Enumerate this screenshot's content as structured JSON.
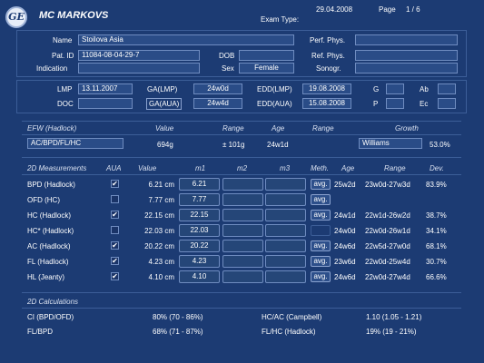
{
  "header": {
    "title": "MC MARKOVS",
    "exam_type_label": "Exam Type:",
    "date": "29.04.2008",
    "page_label": "Page",
    "page_value": "1 / 6",
    "logo_text": "GE"
  },
  "patient": {
    "name_label": "Name",
    "name": "Stoilova Asia",
    "patid_label": "Pat. ID",
    "patid": "11084-08-04-29-7",
    "indication_label": "Indication",
    "indication": "",
    "dob_label": "DOB",
    "dob": "",
    "sex_label": "Sex",
    "sex": "Female",
    "perf_label": "Perf. Phys.",
    "perf": "",
    "ref_label": "Ref. Phys.",
    "ref": "",
    "sono_label": "Sonogr.",
    "sono": ""
  },
  "dates": {
    "lmp_label": "LMP",
    "lmp": "13.11.2007",
    "doc_label": "DOC",
    "doc": "",
    "galmp_label": "GA(LMP)",
    "galmp": "24w0d",
    "gaaua_label": "GA(AUA)",
    "gaaua": "24w4d",
    "eddlmp_label": "EDD(LMP)",
    "eddlmp": "19.08.2008",
    "eddaua_label": "EDD(AUA)",
    "eddaua": "15.08.2008",
    "g_label": "G",
    "g": "",
    "p_label": "P",
    "p": "",
    "ab_label": "Ab",
    "ab": "",
    "ec_label": "Ec",
    "ec": ""
  },
  "efw": {
    "header_label": "EFW (Hadlock)",
    "value_header": "Value",
    "range_header": "Range",
    "age_header": "Age",
    "range2_header": "Range",
    "growth_header": "Growth",
    "formula": "AC/BPD/FL/HC",
    "value": "694g",
    "range": "± 101g",
    "age": "24w1d",
    "growth_ref": "Williams",
    "growth_pct": "53.0%"
  },
  "measurements": {
    "headers": {
      "name": "2D Measurements",
      "aua": "AUA",
      "value": "Value",
      "m1": "m1",
      "m2": "m2",
      "m3": "m3",
      "meth": "Meth.",
      "age": "Age",
      "range": "Range",
      "dev": "Dev."
    },
    "rows": [
      {
        "name": "BPD (Hadlock)",
        "aua": "✔",
        "value": "6.21 cm",
        "m1": "6.21",
        "meth": "avg.",
        "age": "25w2d",
        "range": "23w0d-27w3d",
        "dev": "83.9%"
      },
      {
        "name": "OFD (HC)",
        "aua": "",
        "value": "7.77 cm",
        "m1": "7.77",
        "meth": "avg.",
        "age": "",
        "range": "",
        "dev": ""
      },
      {
        "name": "HC (Hadlock)",
        "aua": "✔",
        "value": "22.15 cm",
        "m1": "22.15",
        "meth": "avg.",
        "age": "24w1d",
        "range": "22w1d-26w2d",
        "dev": "38.7%"
      },
      {
        "name": "HC* (Hadlock)",
        "aua": "",
        "value": "22.03 cm",
        "m1": "22.03",
        "meth": "",
        "age": "24w0d",
        "range": "22w0d-26w1d",
        "dev": "34.1%"
      },
      {
        "name": "AC (Hadlock)",
        "aua": "✔",
        "value": "20.22 cm",
        "m1": "20.22",
        "meth": "avg.",
        "age": "24w6d",
        "range": "22w5d-27w0d",
        "dev": "68.1%"
      },
      {
        "name": "FL (Hadlock)",
        "aua": "✔",
        "value": "4.23 cm",
        "m1": "4.23",
        "meth": "avg.",
        "age": "23w6d",
        "range": "22w0d-25w4d",
        "dev": "30.7%"
      },
      {
        "name": "HL (Jeanty)",
        "aua": "✔",
        "value": "4.10 cm",
        "m1": "4.10",
        "meth": "avg.",
        "age": "24w6d",
        "range": "22w0d-27w4d",
        "dev": "66.6%"
      }
    ]
  },
  "calculations": {
    "header": "2D Calculations",
    "ci_label": "CI (BPD/OFD)",
    "ci_value": "80% (70 - 86%)",
    "flbpd_label": "FL/BPD",
    "flbpd_value": "68% (71 - 87%)",
    "hcac_label": "HC/AC (Campbell)",
    "hcac_value": "1.10 (1.05 - 1.21)",
    "flhc_label": "FL/HC (Hadlock)",
    "flhc_value": "19% (19 - 21%)"
  },
  "colors": {
    "background": "#1c3b73",
    "field": "#2a4c87",
    "border": "#6f8cc0"
  }
}
